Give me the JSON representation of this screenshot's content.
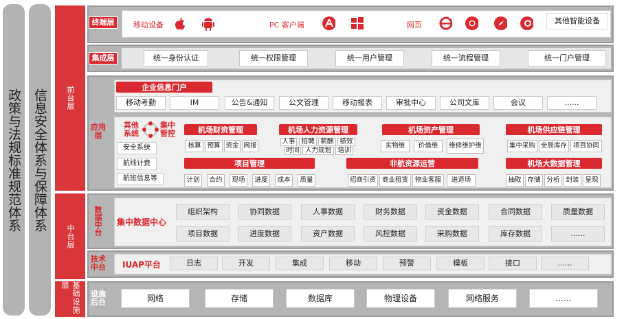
{
  "left": {
    "policy": "政策与法规标准规范体系",
    "security": "信息安全体系与保障体系"
  },
  "columns": {
    "front": "前台层",
    "middle": "中台层",
    "base": "基础设施层"
  },
  "terminal": {
    "tag": "终端层",
    "mobile": "移动设备",
    "pc": "PC 客户端",
    "web": "网页",
    "other": "其他智能设备"
  },
  "integration": {
    "tag": "集成层",
    "items": [
      "统一身份认证",
      "统一权限管理",
      "统一用户管理",
      "统一流程管理",
      "统一门户管理"
    ]
  },
  "application": {
    "tag": "应用层",
    "portal_title": "企业信息门户",
    "portal_items": [
      "移动考勤",
      "IM",
      "公告&通知",
      "公文管理",
      "移动报表",
      "审批中心",
      "公司文库",
      "会议",
      "......"
    ],
    "other_label": "其他系统",
    "center_label": "集中管控",
    "other_items": [
      "安全系统",
      "航线计费",
      "航班信息等"
    ],
    "finance": {
      "title": "机场财资管理",
      "items": [
        "核算",
        "预算",
        "资金",
        "网报"
      ]
    },
    "hr": {
      "title": "机场人力资源管理",
      "items": [
        "人事",
        "招聘",
        "薪酬",
        "绩效",
        "时间",
        "人力规划",
        "培训"
      ]
    },
    "asset": {
      "title": "机场资产管理",
      "items": [
        "实物维",
        "价值维",
        "维修维护维"
      ]
    },
    "supply": {
      "title": "机场供应链管理",
      "items": [
        "集中采购",
        "全局库存",
        "项目协同"
      ]
    },
    "project": {
      "title": "项目管理",
      "items": [
        "计划",
        "合约",
        "现场",
        "进度",
        "成本",
        "质量"
      ]
    },
    "nonaero": {
      "title": "非航资源运营",
      "items": [
        "招商引资",
        "商业租赁",
        "物业客服",
        "进退场"
      ]
    },
    "bigdata": {
      "title": "机场大数据管理",
      "items": [
        "抽取",
        "存储",
        "分析",
        "封装",
        "呈现"
      ]
    }
  },
  "data_center": {
    "tag": "数据中台",
    "title": "集中数据中心",
    "row1": [
      "组织架构",
      "协同数据",
      "人事数据",
      "财务数据",
      "资金数据",
      "合同数据",
      "质量数据"
    ],
    "row2": [
      "项目数据",
      "进度数据",
      "资产数据",
      "风控数据",
      "采购数据",
      "库存数据",
      "......"
    ]
  },
  "tech_center": {
    "tag": "技术中台",
    "title": "IUAP平台",
    "items": [
      "日志",
      "开发",
      "集成",
      "移动",
      "预警",
      "模板",
      "接口",
      "......"
    ]
  },
  "infra": {
    "tag": "设施后台",
    "items": [
      "网络",
      "存储",
      "数据库",
      "物理设备",
      "网络服务",
      "......"
    ]
  },
  "colors": {
    "red": "#d9282e",
    "gray": "#b5b5b5"
  }
}
